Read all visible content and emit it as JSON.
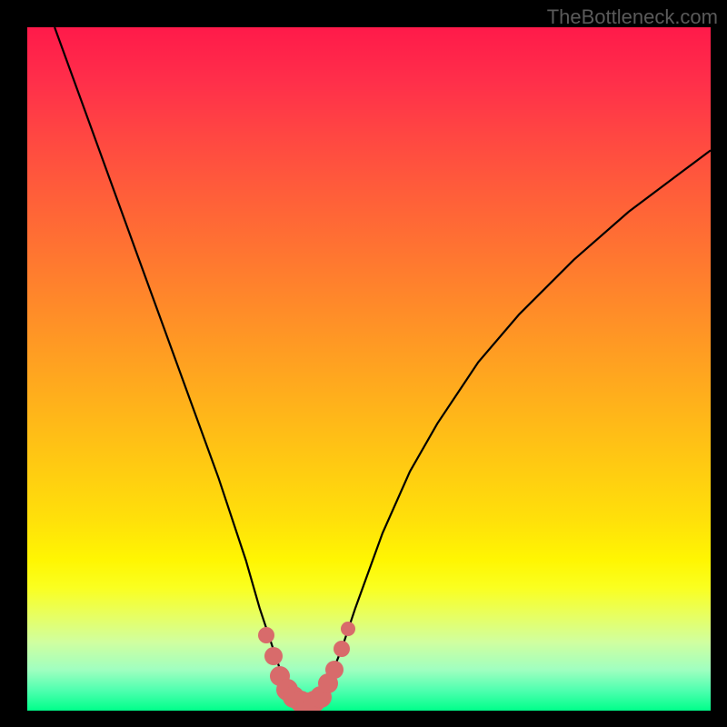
{
  "watermark": "TheBottleneck.com",
  "chart_data": {
    "type": "line",
    "title": "",
    "xlabel": "",
    "ylabel": "",
    "xlim": [
      0,
      100
    ],
    "ylim": [
      0,
      100
    ],
    "background_gradient": {
      "top": "#ff1a4a",
      "mid_upper": "#ff8030",
      "mid": "#ffd010",
      "mid_lower": "#f0ff30",
      "bottom": "#00ff8a"
    },
    "series": [
      {
        "name": "bottleneck-curve",
        "color": "#000000",
        "x": [
          4,
          8,
          12,
          16,
          20,
          24,
          28,
          32,
          34,
          36,
          37,
          38,
          39,
          40,
          41,
          42,
          43,
          44,
          46,
          48,
          52,
          56,
          60,
          66,
          72,
          80,
          88,
          96,
          100
        ],
        "y": [
          100,
          89,
          78,
          67,
          56,
          45,
          34,
          22,
          15,
          9,
          6,
          3.5,
          2,
          1.3,
          1,
          1.3,
          2,
          4,
          9,
          15,
          26,
          35,
          42,
          51,
          58,
          66,
          73,
          79,
          82
        ]
      }
    ],
    "markers": {
      "name": "highlighted-region",
      "color": "#d86b6b",
      "points": [
        {
          "x": 35,
          "y": 11,
          "r": 9
        },
        {
          "x": 36,
          "y": 8,
          "r": 10
        },
        {
          "x": 37,
          "y": 5,
          "r": 11
        },
        {
          "x": 38,
          "y": 3,
          "r": 12
        },
        {
          "x": 39,
          "y": 2,
          "r": 12
        },
        {
          "x": 40,
          "y": 1.3,
          "r": 12
        },
        {
          "x": 41,
          "y": 1,
          "r": 12
        },
        {
          "x": 42,
          "y": 1.3,
          "r": 12
        },
        {
          "x": 43,
          "y": 2,
          "r": 12
        },
        {
          "x": 44,
          "y": 4,
          "r": 11
        },
        {
          "x": 45,
          "y": 6,
          "r": 10
        },
        {
          "x": 46,
          "y": 9,
          "r": 9
        },
        {
          "x": 47,
          "y": 12,
          "r": 8
        }
      ]
    }
  }
}
